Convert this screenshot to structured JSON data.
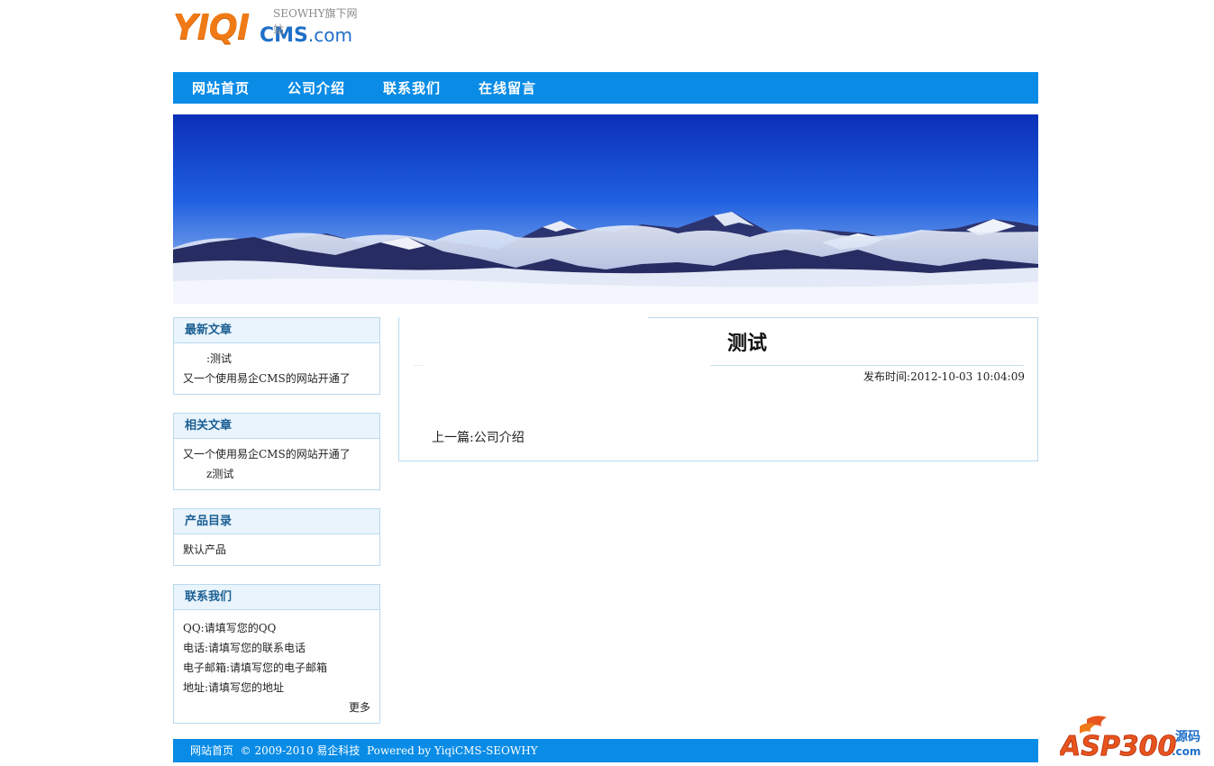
{
  "logo": {
    "brand_yiqi": "YIQI",
    "brand_cms": "CMS",
    "brand_dotcom": ".com",
    "tagline": "SEOWHY旗下网站"
  },
  "nav": {
    "items": [
      "网站首页",
      "公司介绍",
      "联系我们",
      "在线留言"
    ]
  },
  "sidebar": {
    "latest": {
      "title": "最新文章",
      "items": [
        ":测试",
        "又一个使用易企CMS的网站开通了"
      ]
    },
    "related": {
      "title": "相关文章",
      "items": [
        "又一个使用易企CMS的网站开通了",
        "z测试"
      ]
    },
    "products": {
      "title": "产品目录",
      "items": [
        "默认产品"
      ]
    },
    "contact": {
      "title": "联系我们",
      "items": [
        "QQ:请填写您的QQ",
        "电话:请填写您的联系电话",
        "电子邮箱:请填写您的电子邮箱",
        "地址:请填写您的地址"
      ],
      "more": "更多"
    }
  },
  "article": {
    "title": "测试",
    "publish_time": "发布时间:2012-10-03 10:04:09",
    "prev": "上一篇:公司介绍"
  },
  "footer": {
    "text": "网站首页  © 2009-2010 易企科技  Powered by YiqiCMS-SEOWHY"
  },
  "watermark": {
    "text": "ASP300",
    "sub": "源码",
    "domain": ".com"
  },
  "colors": {
    "nav": "#0a8ce6",
    "box_border": "#b9d9ef",
    "box_head": "#eaf4fc",
    "logo_orange": "#f07a16",
    "logo_blue": "#1f6fc8"
  }
}
